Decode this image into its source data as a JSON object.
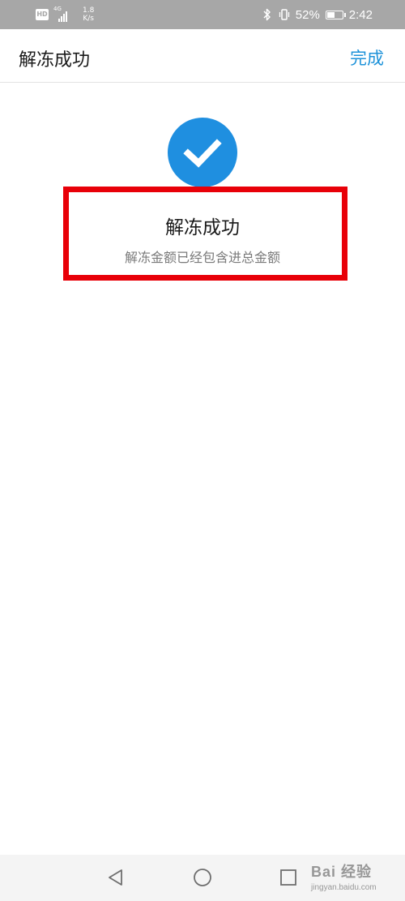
{
  "status_bar": {
    "hd_label": "HD",
    "network_type": "4G",
    "speed_value": "1.8",
    "speed_unit": "K/s",
    "battery_percent": "52%",
    "battery_level": 0.52,
    "time": "2:42",
    "icons": [
      "bluetooth-icon",
      "vibrate-icon",
      "battery-icon"
    ]
  },
  "app_bar": {
    "title": "解冻成功",
    "done_label": "完成",
    "accent_color": "#1d92d9"
  },
  "result": {
    "icon": "check-icon",
    "circle_color": "#1f8fe0",
    "title": "解冻成功",
    "description": "解冻金额已经包含进总金额",
    "highlight_color": "#e80008"
  },
  "nav_bar": {
    "icons": [
      "back-triangle-icon",
      "home-circle-icon",
      "recents-square-icon"
    ]
  },
  "watermark": {
    "main": "Bai 经验",
    "sub": "jingyan.baidu.com"
  }
}
